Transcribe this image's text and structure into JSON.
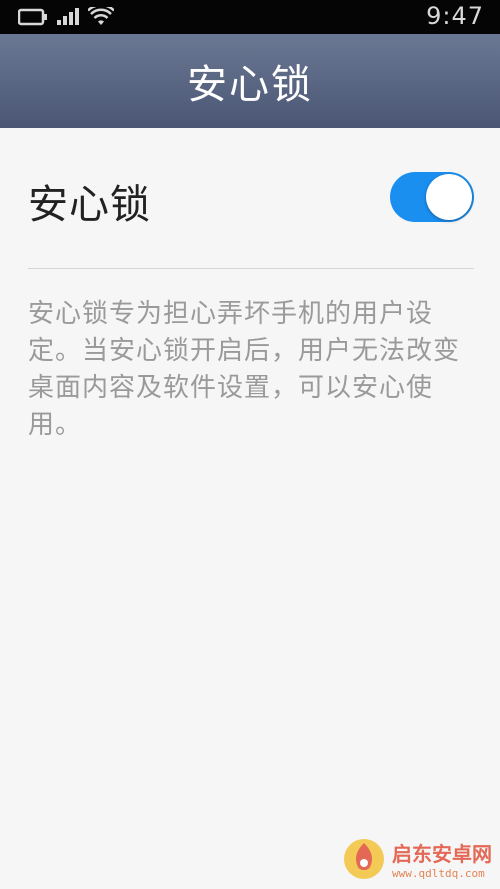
{
  "status_bar": {
    "time": "9:47",
    "icons": [
      "battery-icon",
      "signal-icon",
      "wifi-icon"
    ]
  },
  "header": {
    "title": "安心锁"
  },
  "setting": {
    "label": "安心锁",
    "toggle_state": "on",
    "toggle_color": "#1a8ff0"
  },
  "description": "安心锁专为担心弄坏手机的用户设定。当安心锁开启后，用户无法改变桌面内容及软件设置，可以安心使用。",
  "watermark": {
    "name": "启东安卓网",
    "url": "www.qdltdq.com"
  },
  "colors": {
    "header_bg": "#5a6682",
    "page_bg": "#f6f6f6",
    "accent": "#1a8ff0"
  }
}
